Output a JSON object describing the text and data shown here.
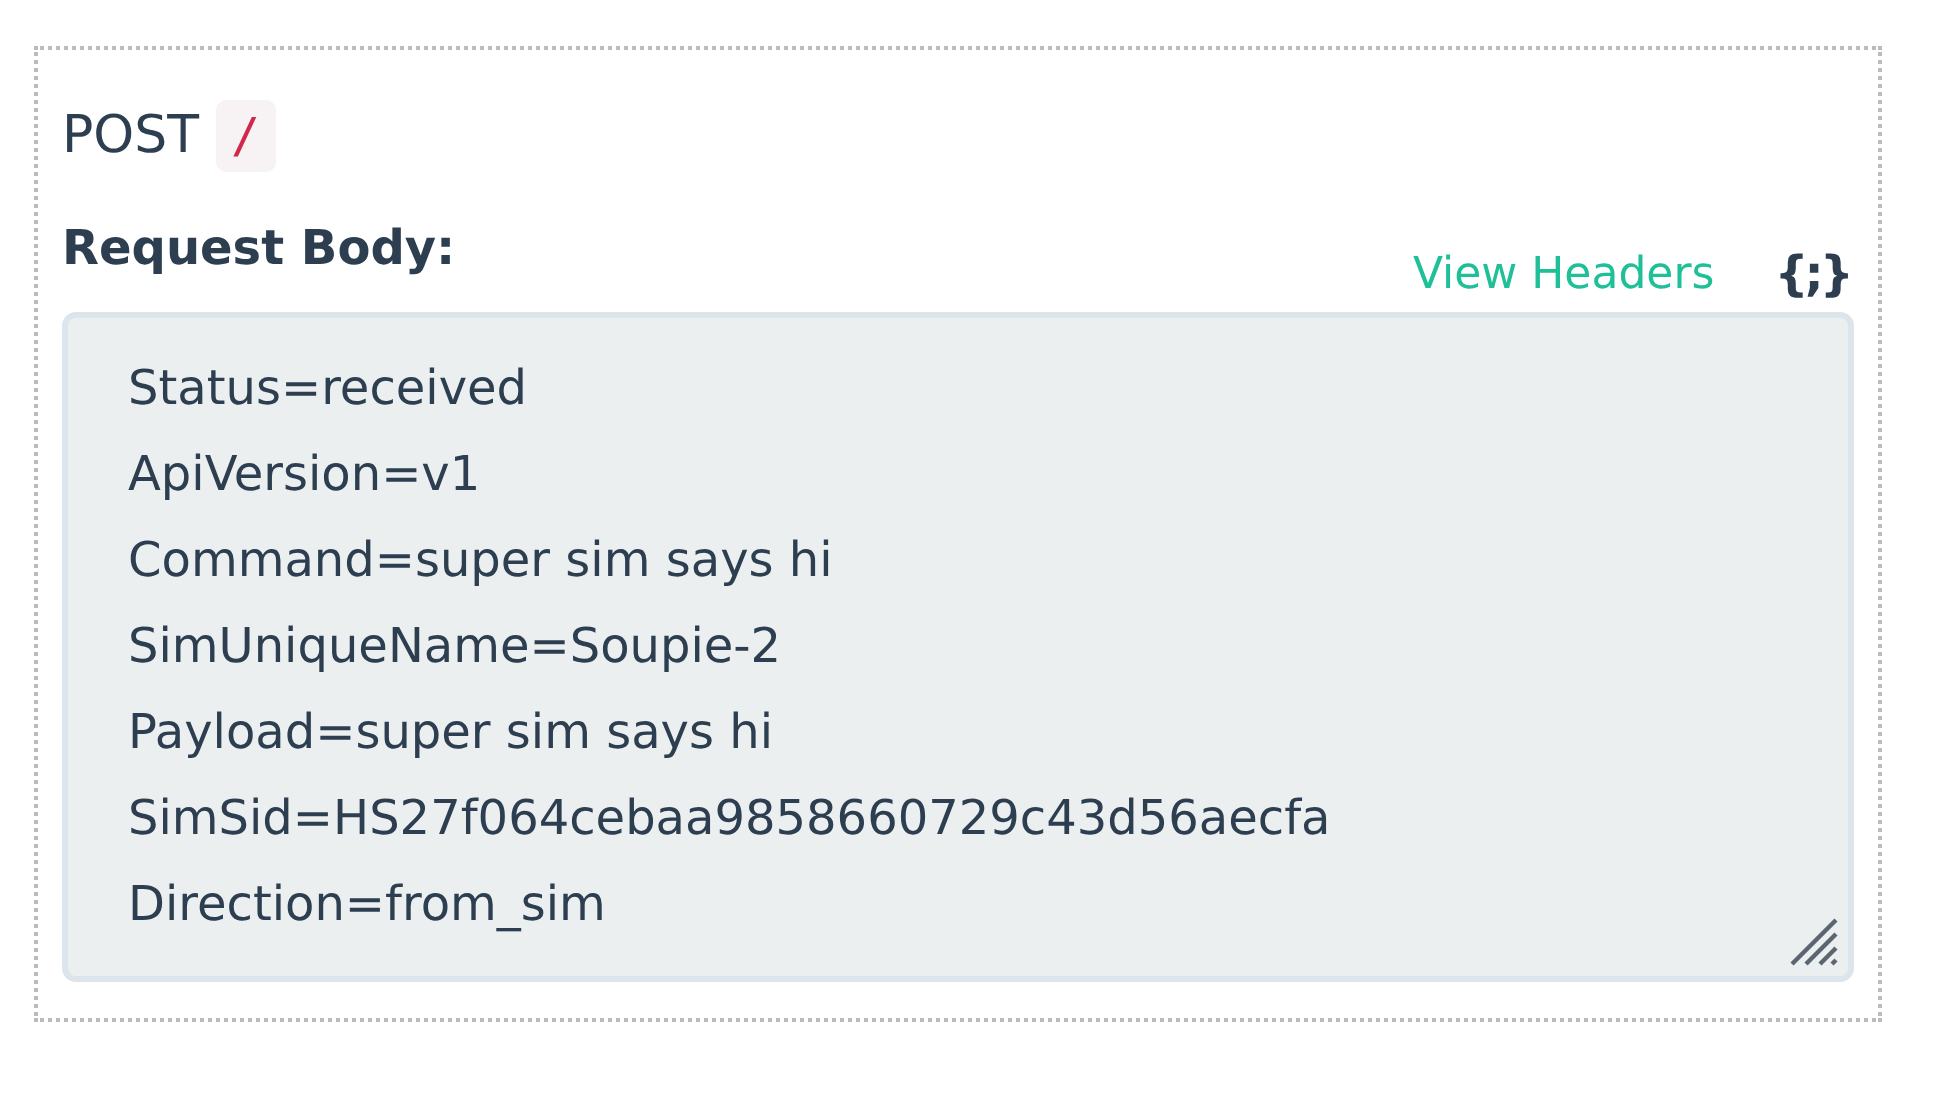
{
  "request": {
    "method": "POST",
    "path": "/"
  },
  "body": {
    "label": "Request Body:",
    "view_headers_link": "View Headers",
    "format_icon": "{;}",
    "lines": [
      "Status=received",
      "ApiVersion=v1",
      "Command=super sim says hi",
      "SimUniqueName=Soupie-2",
      "Payload=super sim says hi",
      "SimSid=HS27f064cebaa9858660729c43d56aecfa",
      "Direction=from_sim"
    ]
  }
}
